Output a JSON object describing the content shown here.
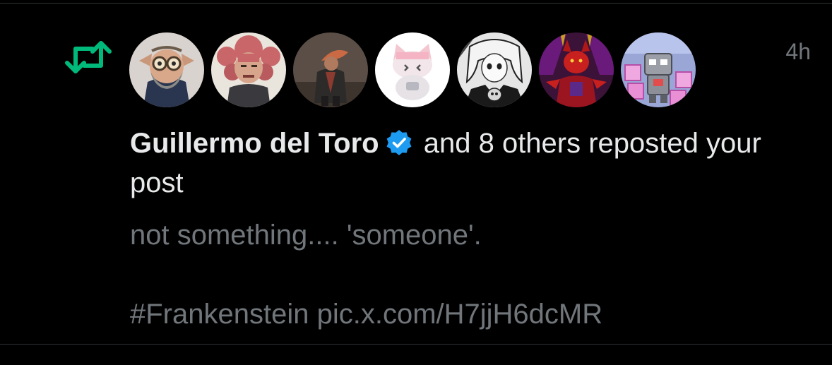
{
  "notification": {
    "type_icon": "repost-icon",
    "timestamp": "4h",
    "avatars": [
      {
        "name": "avatar-1",
        "bg": "#d9d3cf"
      },
      {
        "name": "avatar-2",
        "bg": "#e9e4dc"
      },
      {
        "name": "avatar-3",
        "bg": "#5a4e46"
      },
      {
        "name": "avatar-4",
        "bg": "#ffffff"
      },
      {
        "name": "avatar-5",
        "bg": "#e6e6e6"
      },
      {
        "name": "avatar-6",
        "bg": "#3b1238"
      },
      {
        "name": "avatar-7",
        "bg": "#9aa6d6"
      }
    ],
    "actor_name": "Guillermo del Toro",
    "actor_verified": true,
    "action_text": " and 8 others reposted your post",
    "post_line_1": "not something.... 'someone'.",
    "post_line_2": "#Frankenstein pic.x.com/H7jjH6dcMR"
  },
  "colors": {
    "background": "#000000",
    "repost_green": "#00ba7c",
    "verified_blue": "#1d9bf0",
    "primary_text": "#e7e9ea",
    "secondary_text": "#71767b",
    "divider": "#2f3336"
  }
}
